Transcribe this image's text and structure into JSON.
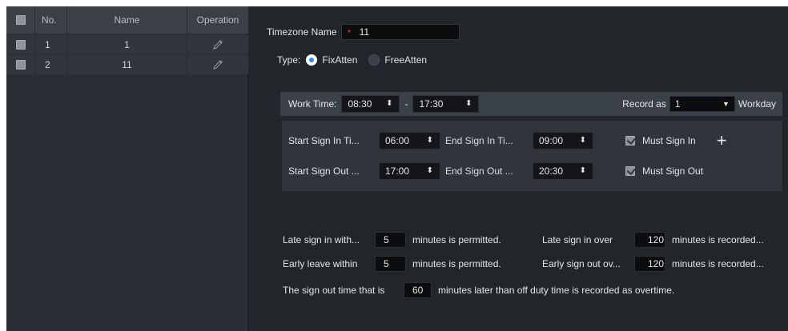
{
  "table": {
    "headers": {
      "no": "No.",
      "name": "Name",
      "operation": "Operation"
    },
    "rows": [
      {
        "no": "1",
        "name": "1"
      },
      {
        "no": "2",
        "name": "11"
      }
    ]
  },
  "form": {
    "timezone_label": "Timezone Name",
    "required_mark": "*",
    "timezone_value": "11",
    "type_label": "Type:",
    "type_options": [
      "FixAtten",
      "FreeAtten"
    ],
    "type_selected": "FixAtten",
    "work_time_label": "Work Time:",
    "work_time_from": "08:30",
    "work_time_sep": "-",
    "work_time_to": "17:30",
    "record_as_label": "Record as",
    "record_as_value": "1",
    "workday_label": "Workday",
    "sign_rows": [
      {
        "start_label": "Start Sign In Ti...",
        "start_value": "06:00",
        "end_label": "End Sign In Ti...",
        "end_value": "09:00",
        "must_label": "Must Sign In",
        "must_checked": true
      },
      {
        "start_label": "Start Sign Out ...",
        "start_value": "17:00",
        "end_label": "End Sign Out ...",
        "end_value": "20:30",
        "must_label": "Must Sign Out",
        "must_checked": true
      }
    ],
    "late_in_label": "Late sign in with...",
    "late_in_value": "5",
    "permitted_1": "minutes is permitted.",
    "late_over_label": "Late sign in over",
    "late_over_value": "120",
    "recorded_1": "minutes is recorded...",
    "early_leave_label": "Early leave within",
    "early_leave_value": "5",
    "permitted_2": "minutes is permitted.",
    "early_out_label": "Early sign out ov...",
    "early_out_value": "120",
    "recorded_2": "minutes is recorded...",
    "overtime_prefix": "The sign out time that is",
    "overtime_value": "60",
    "overtime_suffix": "minutes later than off duty time is recorded as overtime."
  },
  "colors": {
    "accent": "#2b8ee6",
    "required": "#e0303a",
    "panel": "#22262b"
  }
}
